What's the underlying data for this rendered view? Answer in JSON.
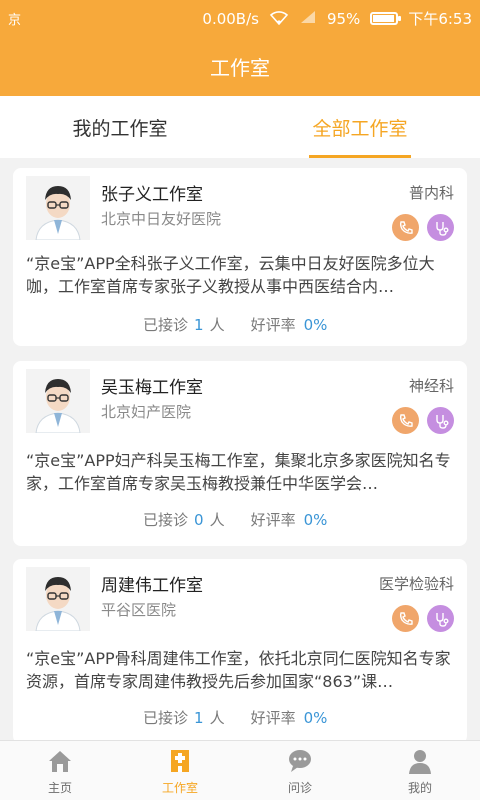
{
  "status_bar": {
    "carrier_icon": "京",
    "speed": "0.00B/s",
    "signal": "ⅹ",
    "battery_text": "95%",
    "battery_level": 0.95,
    "time": "下午6:53"
  },
  "appbar": {
    "title": "工作室"
  },
  "tabs": [
    {
      "label": "我的工作室",
      "active": false
    },
    {
      "label": "全部工作室",
      "active": true
    }
  ],
  "cards": [
    {
      "name": "张子义工作室",
      "department": "普内科",
      "hospital": "北京中日友好医院",
      "description": "“京e宝”APP全科张子义工作室，云集中日友好医院多位大咖，工作室首席专家张子义教授从事中西医结合内…",
      "consult_label": "已接诊",
      "consult_count": "1",
      "consult_unit": "人",
      "rating_label": "好评率",
      "rating_value": "0%"
    },
    {
      "name": "吴玉梅工作室",
      "department": "神经科",
      "hospital": "北京妇产医院",
      "description": "“京e宝”APP妇产科吴玉梅工作室，集聚北京多家医院知名专家，工作室首席专家吴玉梅教授兼任中华医学会…",
      "consult_label": "已接诊",
      "consult_count": "0",
      "consult_unit": "人",
      "rating_label": "好评率",
      "rating_value": "0%"
    },
    {
      "name": "周建伟工作室",
      "department": "医学检验科",
      "hospital": "平谷区医院",
      "description": "“京e宝”APP骨科周建伟工作室，依托北京同仁医院知名专家资源，首席专家周建伟教授先后参加国家“863”课…",
      "consult_label": "已接诊",
      "consult_count": "1",
      "consult_unit": "人",
      "rating_label": "好评率",
      "rating_value": "0%"
    }
  ],
  "bottom_nav": [
    {
      "label": "主页",
      "icon": "home-icon",
      "active": false
    },
    {
      "label": "工作室",
      "icon": "hospital-icon",
      "active": true
    },
    {
      "label": "问诊",
      "icon": "chat-icon",
      "active": false
    },
    {
      "label": "我的",
      "icon": "user-icon",
      "active": false
    }
  ],
  "colors": {
    "primary": "#f7a93b",
    "accent": "#f5a623",
    "link_blue": "#3a95d6",
    "phone_button": "#f0a66b",
    "video_button": "#c58ee0"
  }
}
